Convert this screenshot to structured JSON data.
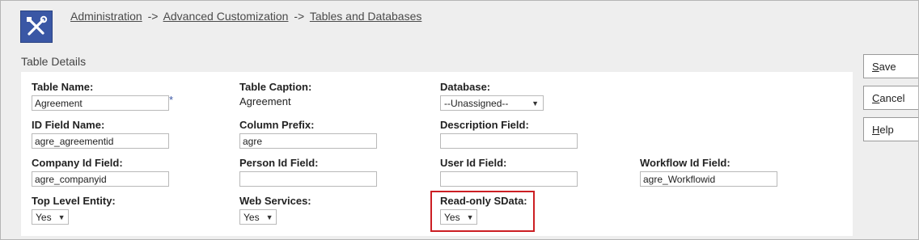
{
  "breadcrumb": {
    "items": [
      "Administration",
      "Advanced Customization",
      "Tables and Databases"
    ],
    "separator": "->"
  },
  "section_title": "Table Details",
  "fields": {
    "table_name": {
      "label": "Table Name:",
      "value": "Agreement",
      "required_mark": "*"
    },
    "table_caption": {
      "label": "Table Caption:",
      "value": "Agreement"
    },
    "database": {
      "label": "Database:",
      "value": "--Unassigned--"
    },
    "id_field_name": {
      "label": "ID Field Name:",
      "value": "agre_agreementid"
    },
    "column_prefix": {
      "label": "Column Prefix:",
      "value": "agre"
    },
    "description_field": {
      "label": "Description Field:",
      "value": ""
    },
    "company_id_field": {
      "label": "Company Id Field:",
      "value": "agre_companyid"
    },
    "person_id_field": {
      "label": "Person Id Field:",
      "value": ""
    },
    "user_id_field": {
      "label": "User Id Field:",
      "value": ""
    },
    "workflow_id_field": {
      "label": "Workflow Id Field:",
      "value": "agre_Workflowid"
    },
    "top_level_entity": {
      "label": "Top Level Entity:",
      "value": "Yes"
    },
    "web_services": {
      "label": "Web Services:",
      "value": "Yes"
    },
    "read_only_sdata": {
      "label": "Read-only SData:",
      "value": "Yes"
    }
  },
  "actions": {
    "save": {
      "first": "S",
      "rest": "ave"
    },
    "cancel": {
      "first": "C",
      "rest": "ancel"
    },
    "help": {
      "first": "H",
      "rest": "elp"
    }
  },
  "colors": {
    "accent": "#3a57a5",
    "highlight": "#cc1f24"
  },
  "icons": [
    "tools-icon",
    "chevron-down-icon"
  ]
}
